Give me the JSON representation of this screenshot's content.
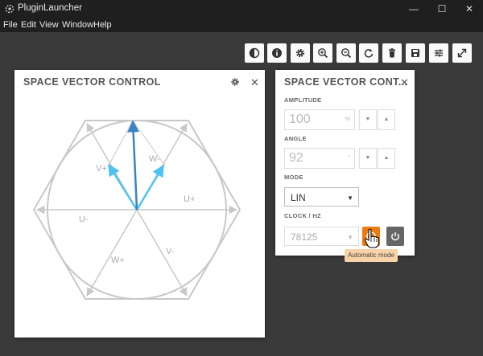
{
  "window": {
    "title": "PluginLauncher",
    "minimize": "—",
    "maximize": "☐",
    "close": "✕"
  },
  "menu": [
    "File",
    "Edit",
    "View",
    "Window",
    "Help"
  ],
  "toolbar": [
    "contrast-icon",
    "info-icon",
    "gear-icon",
    "zoom-in-icon",
    "zoom-out-icon",
    "refresh-icon",
    "trash-icon",
    "save-icon",
    "sliders-icon",
    "expand-icon"
  ],
  "svc_panel": {
    "title": "SPACE VECTOR CONTROL",
    "close": "✕",
    "labels": {
      "u_plus": "U+",
      "u_minus": "U-",
      "v_plus": "V+",
      "v_minus": "V-",
      "w_plus": "W+",
      "w_minus": "W-"
    }
  },
  "ctrl_panel": {
    "title": "SPACE VECTOR CONT...",
    "close": "✕",
    "amplitude": {
      "label": "AMPLITUDE",
      "value": "100",
      "unit": "%"
    },
    "angle": {
      "label": "ANGLE",
      "value": "92",
      "unit": "°"
    },
    "mode": {
      "label": "MODE",
      "value": "LIN"
    },
    "clock": {
      "label": "CLOCK / HZ",
      "value": "78125"
    },
    "tooltip": "Automatic mode",
    "step_down": "▼",
    "step_up": "▲",
    "caret": "▼"
  },
  "colors": {
    "auto_button": "#ee7a0d",
    "power_button": "#666666",
    "vector_main": "#3a84c4",
    "vector_comp": "#4fc3f0",
    "hexagon": "#c8c8c8"
  }
}
